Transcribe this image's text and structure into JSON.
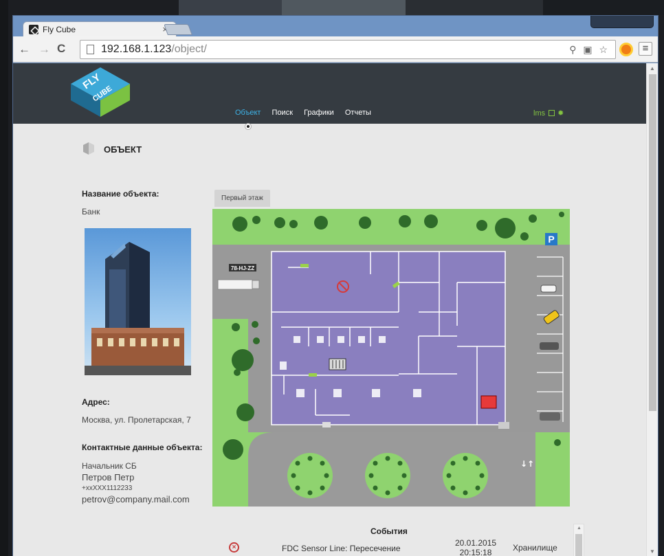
{
  "browser": {
    "tab_title": "Fly Cube",
    "tab_close": "×",
    "url_host": "192.168.1.123",
    "url_path": "/object/",
    "back": "←",
    "forward": "→",
    "reload": "C",
    "omni_icons": "⚲ ▣ ☆",
    "menu": "≡"
  },
  "header": {
    "logo_text_top": "FLY",
    "logo_text_bottom": "CUBE",
    "nav": [
      {
        "label": "Объект",
        "active": true
      },
      {
        "label": "Поиск",
        "active": false
      },
      {
        "label": "Графики",
        "active": false
      },
      {
        "label": "Отчеты",
        "active": false
      }
    ],
    "user": "lms"
  },
  "section": {
    "title": "ОБЪЕКТ"
  },
  "object": {
    "name_label": "Название объекта:",
    "name": "Банк",
    "address_label": "Адрес:",
    "address": "Москва, ул. Пролетарская, 7",
    "contacts_label": "Контактные данные объекта:",
    "contact_role": "Начальник СБ",
    "contact_name": "Петров Петр",
    "contact_phone": "+xxXXX1112233",
    "contact_email": "petrov@company.mail.com"
  },
  "map": {
    "floor_tab": "Первый этаж",
    "truck_plate": "78-HJ-ZZ",
    "parking_sign": "P",
    "flow_arrows": "↓↑",
    "colors": {
      "grass": "#8fd36f",
      "road": "#9a9a9a",
      "building": "#8a7fbf",
      "wall": "#ffffff",
      "tree": "#2f6b2a"
    }
  },
  "events": {
    "title": "События",
    "rows": [
      {
        "name": "FDC Sensor Line: Пересечение",
        "date": "20.01.2015",
        "time": "20:15:18",
        "zone": "Хранилище"
      }
    ]
  }
}
